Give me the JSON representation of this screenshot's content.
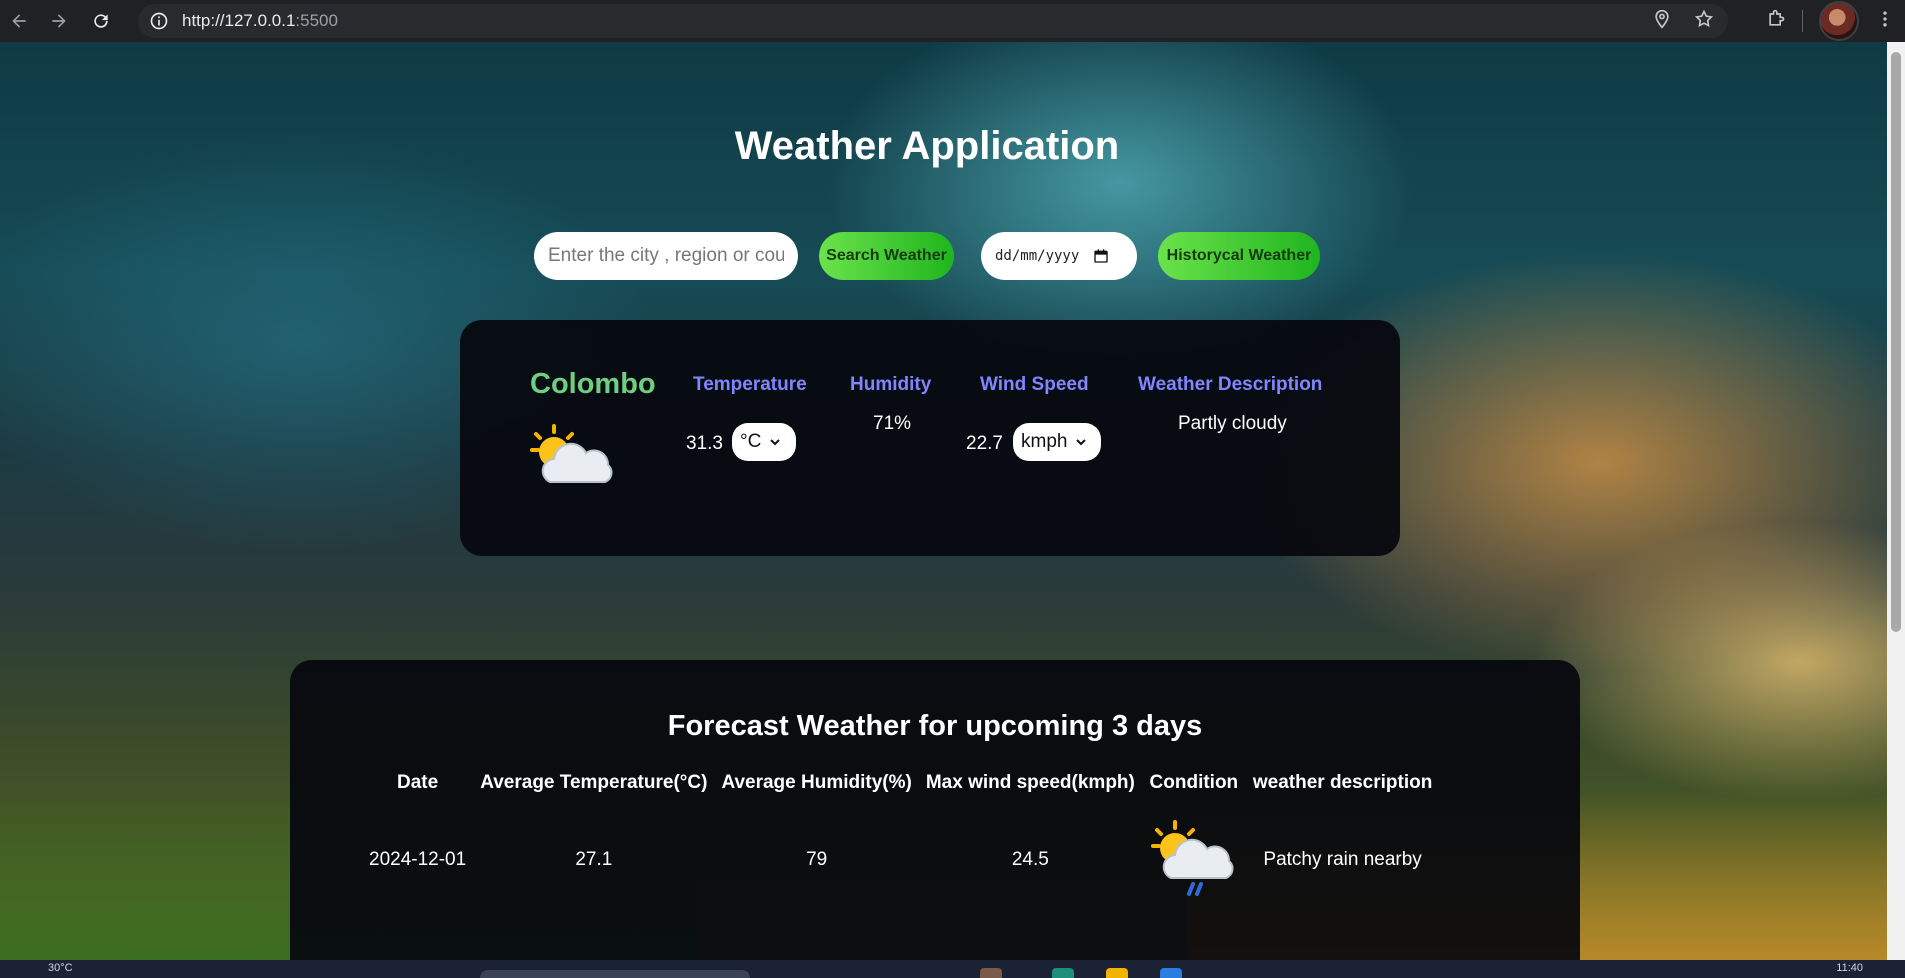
{
  "browser": {
    "url_host": "http://127.0.0.1",
    "url_port": ":5500",
    "icons": [
      "back-icon",
      "forward-icon",
      "reload-icon",
      "site-info-icon",
      "location-icon",
      "star-icon",
      "extensions-icon",
      "menu-icon"
    ]
  },
  "app": {
    "title": "Weather Application",
    "search": {
      "placeholder": "Enter the city , region or country",
      "button_label": "Search Weather"
    },
    "date_input": {
      "placeholder": "dd/mm/yyyy"
    },
    "history_button_label": "Historycal Weather",
    "accent_green": "#4cd137",
    "accent_blue": "#7f86ff"
  },
  "current": {
    "city": "Colombo",
    "icon": "partly-cloudy-icon",
    "temperature": {
      "label": "Temperature",
      "value": "31.3",
      "unit": "°C"
    },
    "humidity": {
      "label": "Humidity",
      "value": "71%"
    },
    "wind": {
      "label": "Wind Speed",
      "value": "22.7",
      "unit": "kmph"
    },
    "description": {
      "label": "Weather Description",
      "value": "Partly cloudy"
    }
  },
  "forecast": {
    "title": "Forecast Weather for upcoming 3 days",
    "columns": [
      "Date",
      "Average Temperature(°C)",
      "Average Humidity(%)",
      "Max wind speed(kmph)",
      "Condition",
      "weather description"
    ],
    "rows": [
      {
        "date": "2024-12-01",
        "avg_temp": "27.1",
        "avg_humidity": "79",
        "max_wind": "24.5",
        "condition_icon": "patchy-rain-icon",
        "description": "Patchy rain nearby"
      }
    ]
  },
  "taskbar": {
    "left_text": "30°C",
    "time": "11:40"
  }
}
